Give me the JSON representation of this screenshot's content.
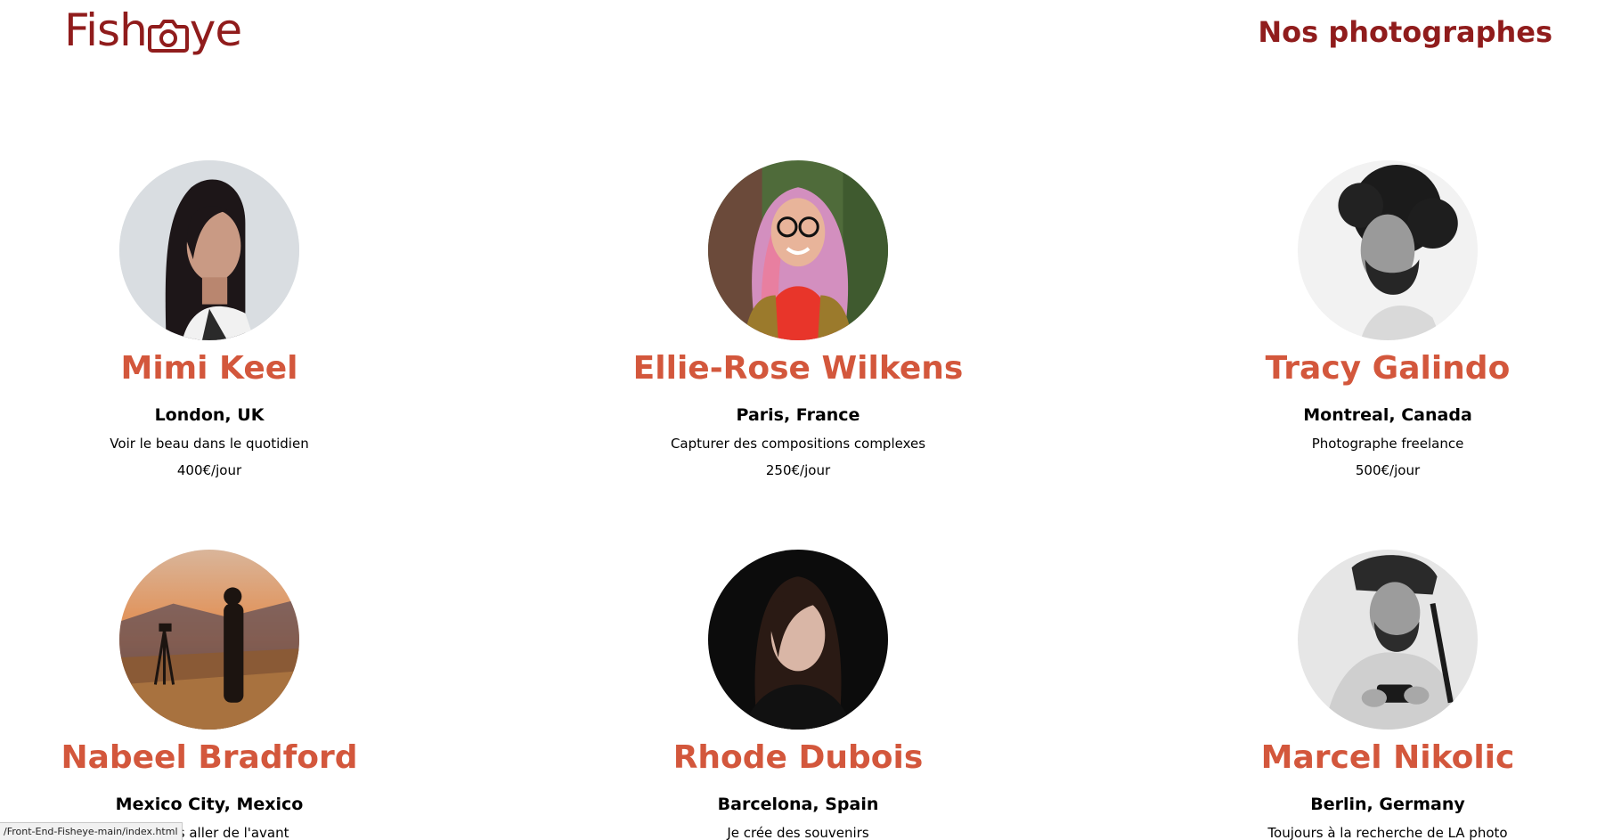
{
  "header": {
    "logo_left": "Fish",
    "logo_right": "ye",
    "page_title": "Nos photographes"
  },
  "colors": {
    "brand": "#901C1C",
    "name": "#D3573C"
  },
  "photographers": [
    {
      "name": "Mimi Keel",
      "location": "London, UK",
      "tagline": "Voir le beau dans le quotidien",
      "price": "400€/jour"
    },
    {
      "name": "Ellie-Rose Wilkens",
      "location": "Paris, France",
      "tagline": "Capturer des compositions complexes",
      "price": "250€/jour"
    },
    {
      "name": "Tracy Galindo",
      "location": "Montreal, Canada",
      "tagline": "Photographe freelance",
      "price": "500€/jour"
    },
    {
      "name": "Nabeel Bradford",
      "location": "Mexico City, Mexico",
      "tagline": "Toujours aller de l'avant",
      "price": ""
    },
    {
      "name": "Rhode Dubois",
      "location": "Barcelona, Spain",
      "tagline": "Je crée des souvenirs",
      "price": ""
    },
    {
      "name": "Marcel Nikolic",
      "location": "Berlin, Germany",
      "tagline": "Toujours à la recherche de LA photo",
      "price": ""
    }
  ],
  "status_bar": {
    "url": "/Front-End-Fisheye-main/index.html"
  }
}
